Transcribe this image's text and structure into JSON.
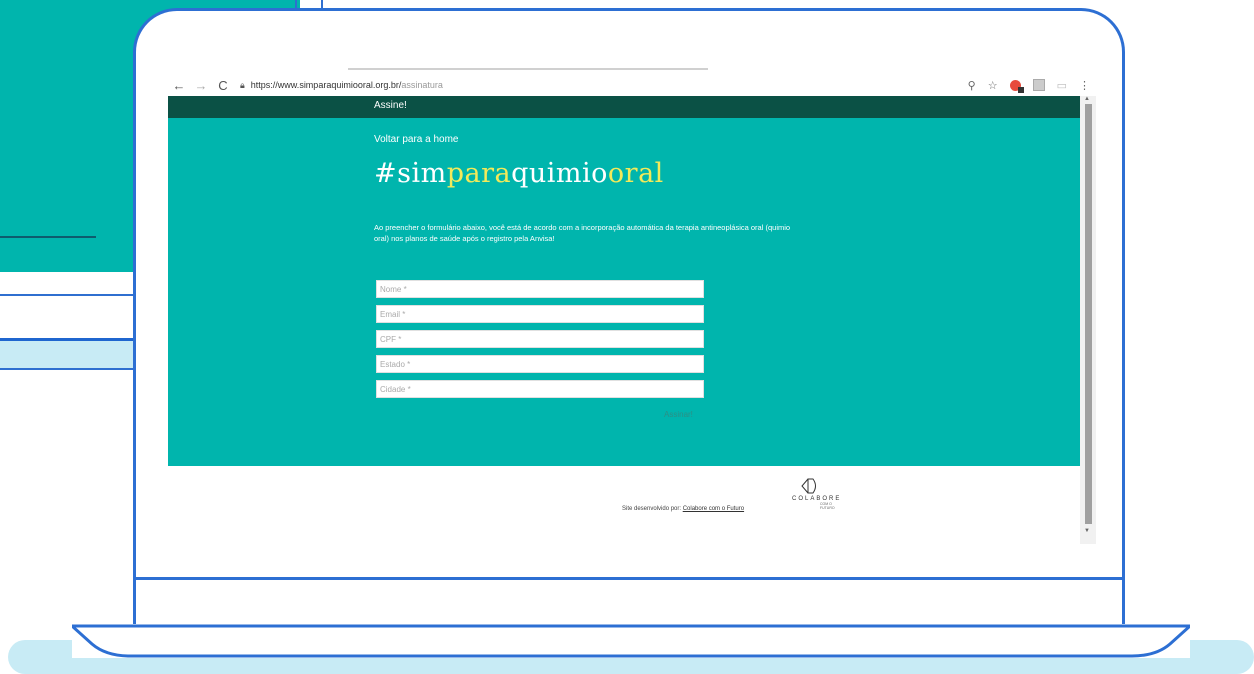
{
  "browser": {
    "url_main": "https://www.simparaquimiooral.org.br/",
    "url_path": "assinatura",
    "back_icon": "arrow-left",
    "forward_icon": "arrow-right",
    "reload_icon": "reload"
  },
  "nav": {
    "link": "Assine!"
  },
  "hero": {
    "back_link": "Voltar para a home",
    "hashtag_parts": [
      "#sim",
      "para",
      "quimio",
      "oral"
    ],
    "intro": "Ao preencher o formulário abaixo, você está de acordo com a incorporação automática da terapia antineoplásica oral (quimio oral) nos planos de saúde após o registro pela Anvisa!"
  },
  "form": {
    "nome_placeholder": "Nome *",
    "email_placeholder": "Email *",
    "cpf_placeholder": "CPF *",
    "estado_placeholder": "Estado *",
    "cidade_placeholder": "Cidade *",
    "submit_label": "Assinar!"
  },
  "footer": {
    "credit_prefix": "Site desenvolvido por: ",
    "credit_link": "Colabore com o Futuro",
    "logo_name": "COLABORE",
    "logo_sub": "COM O FUTURO"
  },
  "colors": {
    "accent": "#00b5ad",
    "nav_bg": "#0b5145",
    "hashtag_yellow": "#f2ea5a",
    "frame_blue": "#2d6fd3"
  }
}
